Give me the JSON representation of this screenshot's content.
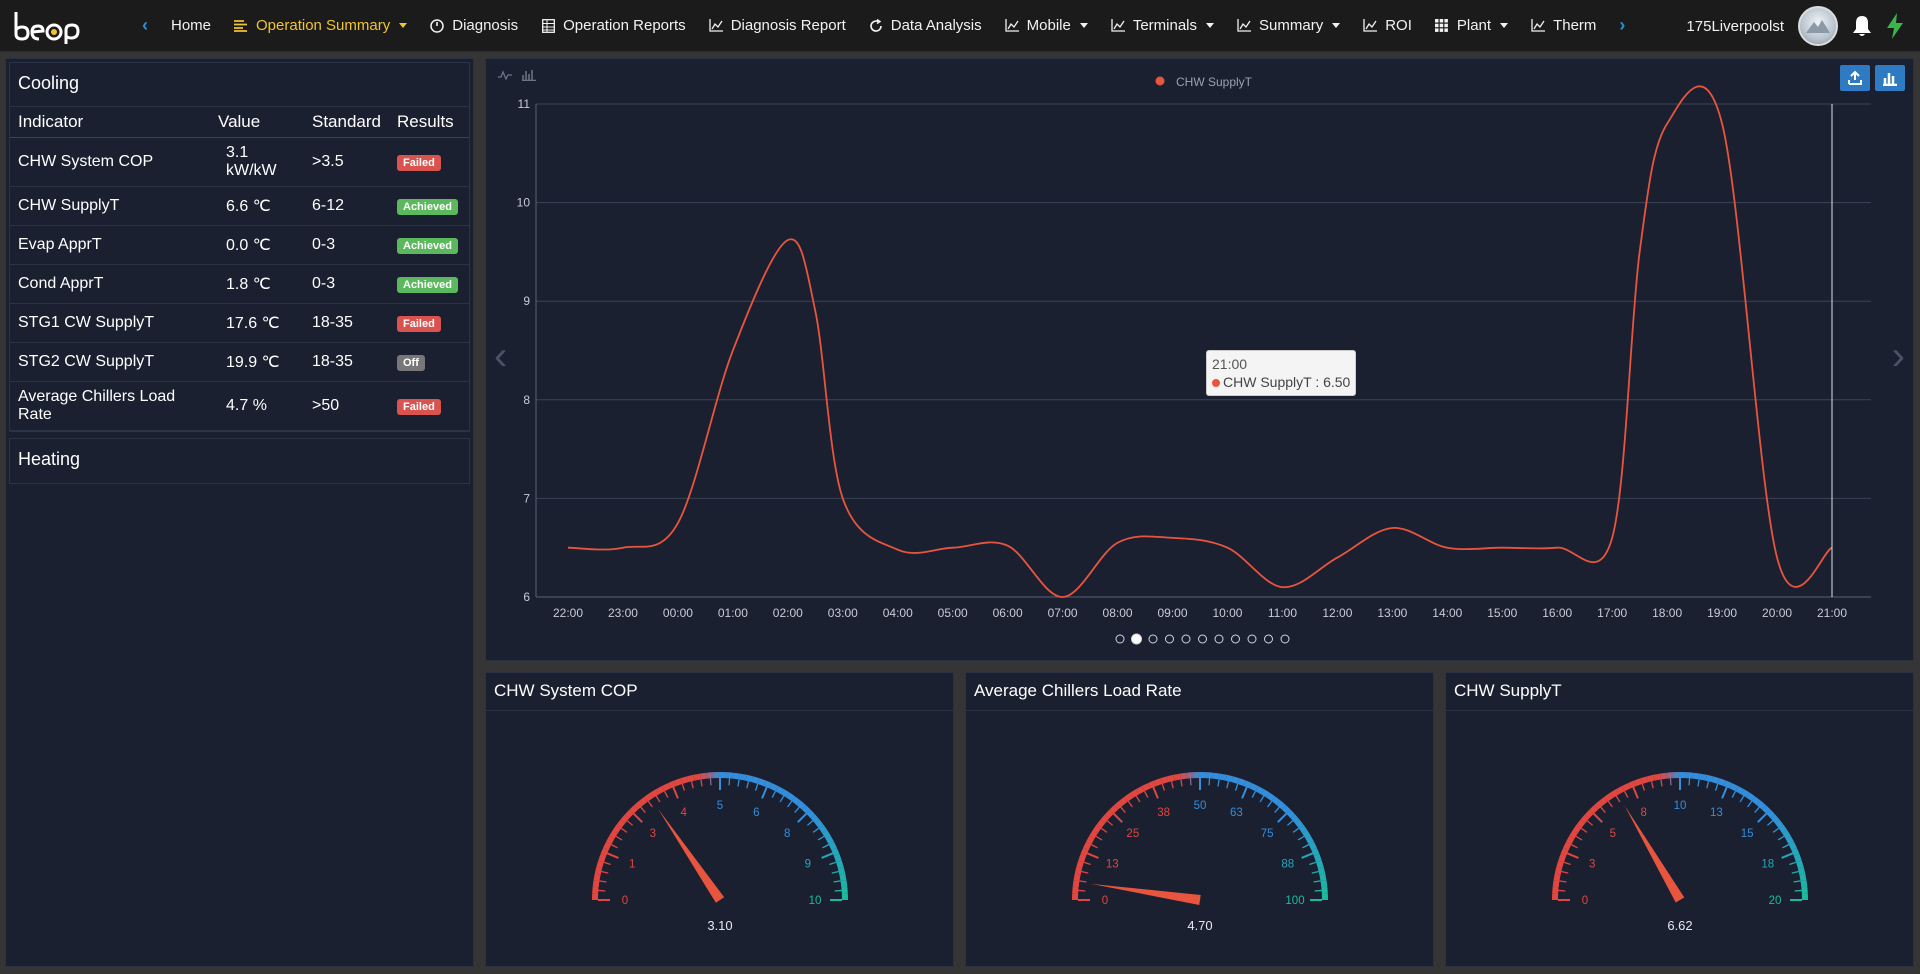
{
  "nav": {
    "brand": "beep",
    "items": [
      {
        "label": "Home",
        "icon": "none",
        "caret": false,
        "active": false
      },
      {
        "label": "Operation Summary",
        "icon": "list-icon",
        "caret": true,
        "active": true
      },
      {
        "label": "Diagnosis",
        "icon": "gauge-icon",
        "caret": false,
        "active": false
      },
      {
        "label": "Operation Reports",
        "icon": "table-icon",
        "caret": false,
        "active": false
      },
      {
        "label": "Diagnosis Report",
        "icon": "line-chart-icon",
        "caret": false,
        "active": false
      },
      {
        "label": "Data Analysis",
        "icon": "refresh-icon",
        "caret": false,
        "active": false
      },
      {
        "label": "Mobile",
        "icon": "line-chart-icon",
        "caret": true,
        "active": false
      },
      {
        "label": "Terminals",
        "icon": "line-chart-icon",
        "caret": true,
        "active": false
      },
      {
        "label": "Summary",
        "icon": "line-chart-icon",
        "caret": true,
        "active": false
      },
      {
        "label": "ROI",
        "icon": "line-chart-icon",
        "caret": false,
        "active": false
      },
      {
        "label": "Plant",
        "icon": "grid-icon",
        "caret": true,
        "active": false
      },
      {
        "label": "Therm",
        "icon": "line-chart-icon",
        "caret": false,
        "active": false
      }
    ],
    "username": "175Liverpoolst"
  },
  "cooling": {
    "title": "Cooling",
    "headers": [
      "Indicator",
      "Value",
      "Standard",
      "Results"
    ],
    "rows": [
      {
        "indicator": "CHW System COP",
        "value": "3.1 kW/kW",
        "standard": ">3.5",
        "result": "Failed",
        "status": "failed"
      },
      {
        "indicator": "CHW SupplyT",
        "value": "6.6 ℃",
        "standard": "6-12",
        "result": "Achieved",
        "status": "achieved"
      },
      {
        "indicator": "Evap ApprT",
        "value": "0.0 ℃",
        "standard": "0-3",
        "result": "Achieved",
        "status": "achieved"
      },
      {
        "indicator": "Cond ApprT",
        "value": "1.8 ℃",
        "standard": "0-3",
        "result": "Achieved",
        "status": "achieved"
      },
      {
        "indicator": "STG1 CW SupplyT",
        "value": "17.6 ℃",
        "standard": "18-35",
        "result": "Failed",
        "status": "failed"
      },
      {
        "indicator": "STG2 CW SupplyT",
        "value": "19.9 ℃",
        "standard": "18-35",
        "result": "Off",
        "status": "off"
      },
      {
        "indicator": "Average Chillers Load Rate",
        "value": "4.7 %",
        "standard": ">50",
        "result": "Failed",
        "status": "failed"
      }
    ]
  },
  "heating": {
    "title": "Heating"
  },
  "chart_data": {
    "type": "line",
    "series": [
      {
        "name": "CHW SupplyT",
        "color": "#e8553e"
      }
    ],
    "categories": [
      "22:00",
      "23:00",
      "00:00",
      "01:00",
      "02:00",
      "03:00",
      "04:00",
      "05:00",
      "06:00",
      "07:00",
      "08:00",
      "09:00",
      "10:00",
      "11:00",
      "12:00",
      "13:00",
      "14:00",
      "15:00",
      "16:00",
      "17:00",
      "18:00",
      "19:00",
      "20:00",
      "21:00"
    ],
    "points": [
      [
        0,
        6.5
      ],
      [
        1,
        6.5
      ],
      [
        2,
        6.75
      ],
      [
        3,
        8.5
      ],
      [
        4,
        9.62
      ],
      [
        4.5,
        8.9
      ],
      [
        5,
        7.0
      ],
      [
        6,
        6.48
      ],
      [
        7,
        6.5
      ],
      [
        8,
        6.52
      ],
      [
        9,
        6.0
      ],
      [
        10,
        6.55
      ],
      [
        11,
        6.6
      ],
      [
        12,
        6.5
      ],
      [
        13,
        6.1
      ],
      [
        14,
        6.4
      ],
      [
        15,
        6.7
      ],
      [
        16,
        6.5
      ],
      [
        17,
        6.5
      ],
      [
        18,
        6.5
      ],
      [
        19,
        6.6
      ],
      [
        19.5,
        9.5
      ],
      [
        20,
        10.8
      ],
      [
        21,
        10.8
      ],
      [
        22,
        6.4
      ],
      [
        23,
        6.5
      ]
    ],
    "ylim": [
      6,
      11
    ],
    "yticks": [
      6,
      7,
      8,
      9,
      10,
      11
    ],
    "grid": true,
    "legend": "top-center",
    "tooltip": {
      "title": "21:00",
      "label": "CHW SupplyT : 6.50"
    },
    "pages": 11,
    "active_page": 2
  },
  "gauges": [
    {
      "title": "CHW System COP",
      "min": 0,
      "max": 10,
      "value": 3.1,
      "display": "3.10",
      "ticks": [
        "0",
        "1",
        "3",
        "4",
        "5",
        "6",
        "8",
        "9",
        "10"
      ]
    },
    {
      "title": "Average Chillers Load Rate",
      "min": 0,
      "max": 100,
      "value": 4.7,
      "display": "4.70",
      "ticks": [
        "0",
        "13",
        "25",
        "38",
        "50",
        "63",
        "75",
        "88",
        "100"
      ]
    },
    {
      "title": "CHW SupplyT",
      "min": 0,
      "max": 20,
      "value": 6.62,
      "display": "6.62",
      "ticks": [
        "0",
        "3",
        "5",
        "8",
        "10",
        "13",
        "15",
        "18",
        "20"
      ]
    }
  ]
}
